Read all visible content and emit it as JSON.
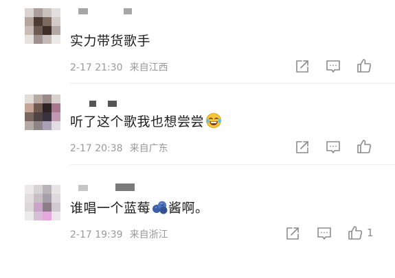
{
  "comments": [
    {
      "text": "实力带货歌手",
      "date": "2-17 21:30",
      "location": "来自江西",
      "like_count": "",
      "share_icon": "share-edit-icon",
      "comment_icon": "comment-bubble-icon",
      "like_icon": "thumbs-up-icon"
    },
    {
      "text": "听了这个歌我也想尝尝",
      "emoji": "laughing-tears-emoji",
      "date": "2-17 20:38",
      "location": "来自广东",
      "like_count": "",
      "share_icon": "share-edit-icon",
      "comment_icon": "comment-bubble-icon",
      "like_icon": "thumbs-up-icon"
    },
    {
      "text_before": "谁唱一个蓝莓",
      "emoji": "blueberry-emoji",
      "text_after": "酱啊。",
      "date": "2-17 19:39",
      "location": "来自浙江",
      "like_count": "1",
      "share_icon": "share-edit-icon",
      "comment_icon": "comment-bubble-icon",
      "like_icon": "thumbs-up-icon"
    }
  ],
  "colors": {
    "text": "#1e1e1e",
    "meta": "#9a9a9a",
    "icon": "#8a8a8a",
    "divider": "#ececec"
  }
}
